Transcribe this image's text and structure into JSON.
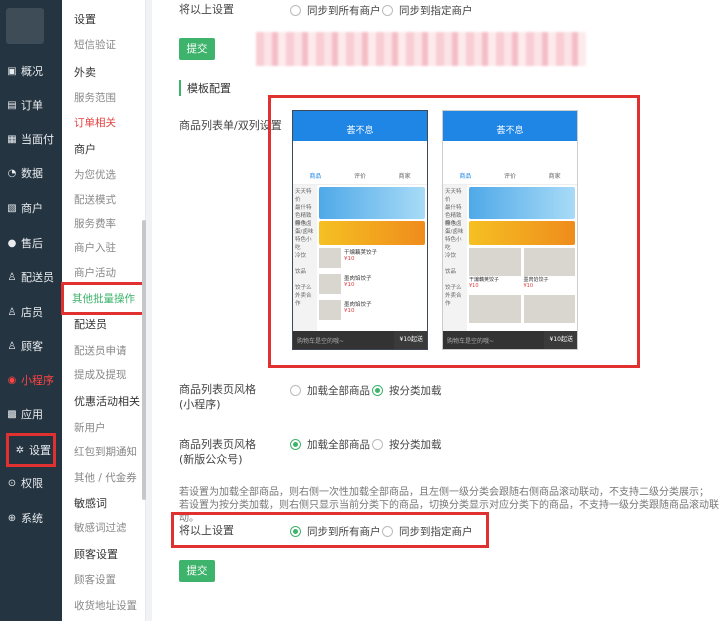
{
  "sidebar": {
    "items": [
      {
        "label": "概况",
        "icon": "dashboard-icon",
        "glyph": "▣"
      },
      {
        "label": "订单",
        "icon": "order-icon",
        "glyph": "▤"
      },
      {
        "label": "当面付",
        "icon": "pay-icon",
        "glyph": "▦"
      },
      {
        "label": "数据",
        "icon": "data-icon",
        "glyph": "◔"
      },
      {
        "label": "商户",
        "icon": "shop-icon",
        "glyph": "▧"
      },
      {
        "label": "售后",
        "icon": "service-icon",
        "glyph": "●"
      },
      {
        "label": "配送员",
        "icon": "rider-icon",
        "glyph": "♙"
      },
      {
        "label": "店员",
        "icon": "clerk-icon",
        "glyph": "♙"
      },
      {
        "label": "顾客",
        "icon": "customer-icon",
        "glyph": "♙"
      },
      {
        "label": "小程序",
        "icon": "miniprogram-icon",
        "glyph": "◉"
      },
      {
        "label": "应用",
        "icon": "app-icon",
        "glyph": "▩"
      },
      {
        "label": "设置",
        "icon": "settings-icon",
        "glyph": "✲"
      },
      {
        "label": "权限",
        "icon": "permission-icon",
        "glyph": "⊙"
      },
      {
        "label": "系统",
        "icon": "system-icon",
        "glyph": "⊕"
      }
    ]
  },
  "subnav": {
    "title": "设置",
    "items": [
      "短信验证",
      "外卖",
      "服务范围",
      "订单相关",
      "商户",
      "为您优选",
      "配送模式",
      "服务费率",
      "商户入驻",
      "商户活动",
      "其他批量操作",
      "配送员",
      "配送员申请",
      "提成及提现",
      "优惠活动相关",
      "新用户",
      "红包到期通知",
      "其他 / 代金券",
      "敏感词",
      "敏感词过滤",
      "顾客设置",
      "顾客设置",
      "收货地址设置"
    ]
  },
  "main": {
    "top_label": "将以上设置",
    "top_options": [
      "同步到所有商户",
      "同步到指定商户"
    ],
    "submit": "提交",
    "section_title": "模板配置",
    "list_style_label": "商品列表单/双列设置",
    "phone": {
      "title": "荟不息",
      "tabs": [
        "商品",
        "评价",
        "商家"
      ],
      "cats": [
        "天天特价",
        "最什特色精致摩卡",
        "特色卤蛋/卤味",
        "特色小吃",
        "冷饮",
        "饮品",
        "饺子么外卖合作"
      ],
      "dish1": "干煸藕荚饺子",
      "dish2": "墨肉馅饺子",
      "price": "¥10",
      "cart_hint": "购物车是空的哦~",
      "cart_btn": "¥10起送"
    },
    "mp_label": "商品列表页风格\n(小程序)",
    "mp_options": [
      "加载全部商品",
      "按分类加载"
    ],
    "gzh_label": "商品列表页风格\n(新版公众号)",
    "gzh_options": [
      "加载全部商品",
      "按分类加载"
    ],
    "note": "若设置为加载全部商品，则右侧一次性加载全部商品，且左侧一级分类会跟随右侧商品滚动联动，不支持二级分类展示；\n若设置为按分类加载，则右侧只显示当前分类下的商品，切换分类显示对应分类下的商品，不支持一级分类跟随商品滚动联动。",
    "bottom_label": "将以上设置",
    "bottom_options": [
      "同步到所有商户",
      "同步到指定商户"
    ],
    "submit2": "提交"
  }
}
